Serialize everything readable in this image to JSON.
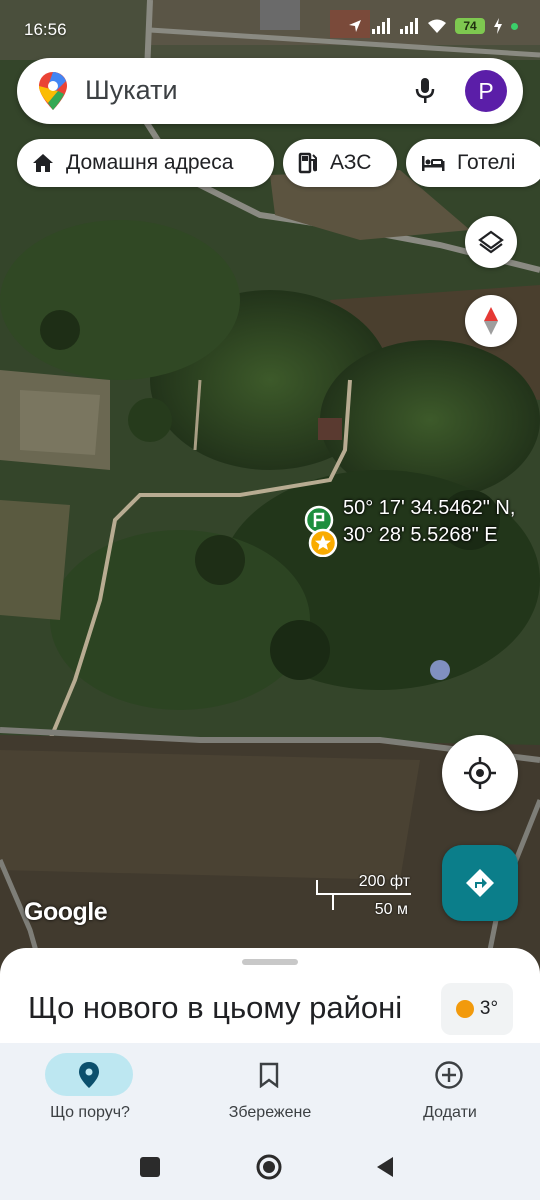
{
  "status_bar": {
    "time": "16:56",
    "battery": "74"
  },
  "search": {
    "placeholder": "Шукати",
    "avatar_letter": "P"
  },
  "chips": [
    {
      "label": "Домашня адреса",
      "icon": "home-icon"
    },
    {
      "label": "АЗС",
      "icon": "gas-station-icon"
    },
    {
      "label": "Готелі",
      "icon": "hotel-icon"
    }
  ],
  "map": {
    "coordinates_line1": "50° 17' 34.5462\" N,",
    "coordinates_line2": "30° 28' 5.5268\" E",
    "scale_ft": "200 фт",
    "scale_m": "50 м",
    "logo": "Google"
  },
  "sheet": {
    "title": "Що нового в цьому районі",
    "weather_temp": "3°"
  },
  "bottom_nav": [
    {
      "label": "Що поруч?",
      "icon": "location-pin-icon",
      "active": true
    },
    {
      "label": "Збережене",
      "icon": "bookmark-icon",
      "active": false
    },
    {
      "label": "Додати",
      "icon": "add-circle-icon",
      "active": false
    }
  ],
  "colors": {
    "accent": "#0b7e8a",
    "avatar": "#5b1ea8",
    "active_pill": "#bde7f1"
  }
}
